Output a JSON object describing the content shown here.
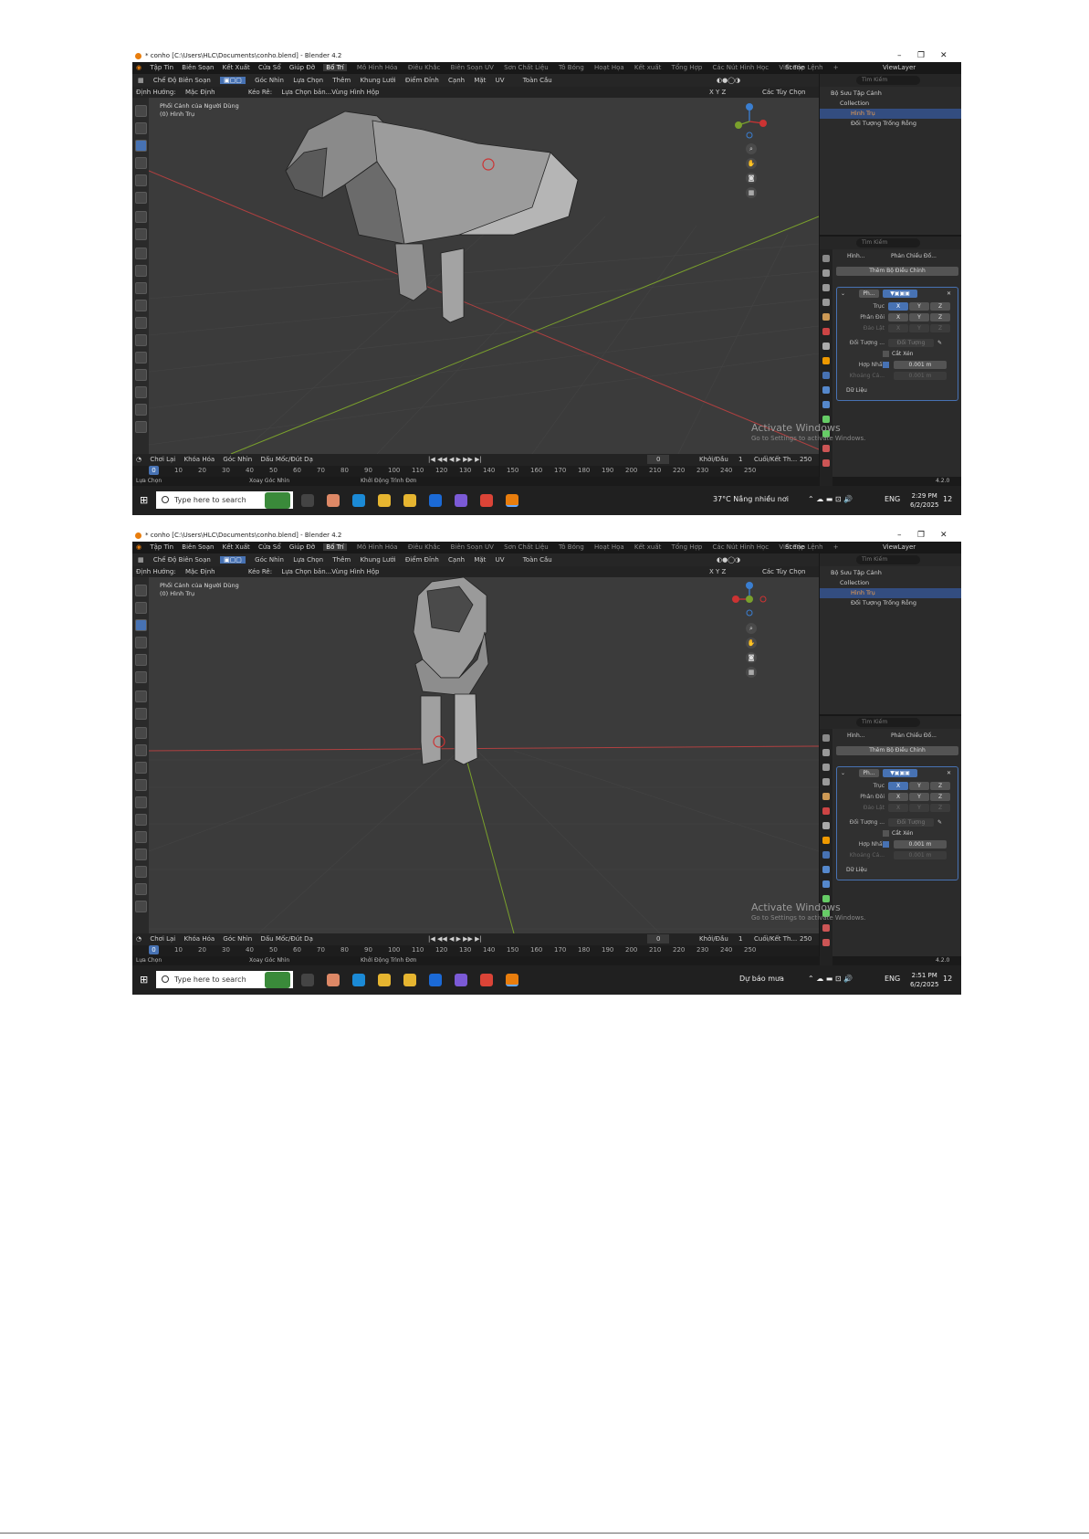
{
  "shots": [
    {
      "title_text": "* conho [C:\\Users\\HLC\\Documents\\conho.blend] - Blender 4.2",
      "menu": [
        "Tập Tin",
        "Biên Soạn",
        "Kết Xuất",
        "Cửa Sổ",
        "Giúp Đỡ"
      ],
      "workspaces": [
        "Bố Trí",
        "Mô Hình Hóa",
        "Điêu Khắc",
        "Biên Soạn UV",
        "Sơn Chất Liệu",
        "Tô Bóng",
        "Hoạt Họa",
        "Kết xuất",
        "Tổng Hợp",
        "Các Nút Hình Học",
        "Viết Tập Lệnh",
        "+"
      ],
      "scene": "Scene",
      "view_layer": "ViewLayer",
      "header": [
        "Chế Độ Biên Soạn",
        "Góc Nhìn",
        "Lựa Chọn",
        "Thêm",
        "Khung Lưới",
        "Điểm Đỉnh",
        "Cạnh",
        "Mặt",
        "UV",
        "Toàn Cầu"
      ],
      "header2": [
        "Định Hướng:",
        "Mặc Định",
        "Kéo Rê:",
        "Lựa Chọn bản...Vùng Hình Hộp"
      ],
      "axes_label": "X Y Z",
      "options_label": "Các Tùy Chọn",
      "view_name": "Phối Cảnh của Người Dùng",
      "object_name": "(0) Hình Trụ",
      "timeline_menu": [
        "Chơi Lại",
        "Khóa Hóa",
        "Góc Nhìn",
        "Dấu Mốc/Đút Dạ"
      ],
      "frame_current": "0",
      "start_label": "Khởi/Đầu",
      "start_value": "1",
      "end_label": "Cuối/Kết Th...",
      "end_value": "250",
      "frame_numbers": [
        "0",
        "10",
        "20",
        "30",
        "40",
        "50",
        "60",
        "70",
        "80",
        "90",
        "100",
        "110",
        "120",
        "130",
        "140",
        "150",
        "160",
        "170",
        "180",
        "190",
        "200",
        "210",
        "220",
        "230",
        "240",
        "250"
      ],
      "status_items": [
        "Lựa Chọn",
        "Xoay Góc Nhìn",
        "Khởi Động Trình Đơn"
      ],
      "version": "4.2.0",
      "outliner": {
        "search_placeholder": "Tìm Kiếm",
        "rows": [
          "Bộ Sưu Tập Cảnh",
          "Collection",
          "Hình Trụ",
          "Đối Tượng Trống Rỗng"
        ]
      },
      "props": {
        "search_placeholder": "Tìm Kiếm",
        "breadcrumb_a": "Hình...",
        "breadcrumb_b": "Phản Chiếu Đố...",
        "add_modifier": "Thêm Bộ Điều Chỉnh",
        "modifier_name": "Ph...",
        "axis_label": "Trục",
        "bisect_label": "Phân Đôi",
        "flip_label": "Đảo Lật",
        "mirror_object_label": "Đối Tượng ...",
        "mirror_object_placeholder": "Đối Tượng",
        "clipping_label": "Cắt Xén",
        "merge_label": "Hợp Nhất",
        "merge_value": "0.001 m",
        "distance_label": "Khoảng Cá...",
        "distance_value": "0.001 m",
        "data_label": "Dữ Liệu",
        "x": "X",
        "y": "Y",
        "z": "Z"
      },
      "activate_title": "Activate Windows",
      "activate_sub": "Go to Settings to activate Windows.",
      "taskbar_search": "Type here to search",
      "weather": "37°C  Nắng nhiều nơi",
      "lang": "ENG",
      "time": "2:29 PM",
      "date": "6/2/2025",
      "notif": "12"
    },
    {
      "title_text": "* conho [C:\\Users\\HLC\\Documents\\conho.blend] - Blender 4.2",
      "menu": [
        "Tập Tin",
        "Biên Soạn",
        "Kết Xuất",
        "Cửa Sổ",
        "Giúp Đỡ"
      ],
      "workspaces": [
        "Bố Trí",
        "Mô Hình Hóa",
        "Điêu Khắc",
        "Biên Soạn UV",
        "Sơn Chất Liệu",
        "Tô Bóng",
        "Hoạt Họa",
        "Kết xuất",
        "Tổng Hợp",
        "Các Nút Hình Học",
        "Viết Tập Lệnh",
        "+"
      ],
      "scene": "Scene",
      "view_layer": "ViewLayer",
      "header": [
        "Chế Độ Biên Soạn",
        "Góc Nhìn",
        "Lựa Chọn",
        "Thêm",
        "Khung Lưới",
        "Điểm Đỉnh",
        "Cạnh",
        "Mặt",
        "UV",
        "Toàn Cầu"
      ],
      "header2": [
        "Định Hướng:",
        "Mặc Định",
        "Kéo Rê:",
        "Lựa Chọn bản...Vùng Hình Hộp"
      ],
      "axes_label": "X Y Z",
      "options_label": "Các Tùy Chọn",
      "view_name": "Phối Cảnh của Người Dùng",
      "object_name": "(0) Hình Trụ",
      "timeline_menu": [
        "Chơi Lại",
        "Khóa Hóa",
        "Góc Nhìn",
        "Dấu Mốc/Đút Dạ"
      ],
      "frame_current": "0",
      "start_label": "Khởi/Đầu",
      "start_value": "1",
      "end_label": "Cuối/Kết Th...",
      "end_value": "250",
      "frame_numbers": [
        "0",
        "10",
        "20",
        "30",
        "40",
        "50",
        "60",
        "70",
        "80",
        "90",
        "100",
        "110",
        "120",
        "130",
        "140",
        "150",
        "160",
        "170",
        "180",
        "190",
        "200",
        "210",
        "220",
        "230",
        "240",
        "250"
      ],
      "status_items": [
        "Lựa Chọn",
        "Xoay Góc Nhìn",
        "Khởi Động Trình Đơn"
      ],
      "version": "4.2.0",
      "outliner": {
        "search_placeholder": "Tìm Kiếm",
        "rows": [
          "Bộ Sưu Tập Cảnh",
          "Collection",
          "Hình Trụ",
          "Đối Tượng Trống Rỗng"
        ]
      },
      "props": {
        "search_placeholder": "Tìm Kiếm",
        "breadcrumb_a": "Hình...",
        "breadcrumb_b": "Phản Chiếu Đố...",
        "add_modifier": "Thêm Bộ Điều Chỉnh",
        "modifier_name": "Ph...",
        "axis_label": "Trục",
        "bisect_label": "Phân Đôi",
        "flip_label": "Đảo Lật",
        "mirror_object_label": "Đối Tượng ...",
        "mirror_object_placeholder": "Đối Tượng",
        "clipping_label": "Cắt Xén",
        "merge_label": "Hợp Nhất",
        "merge_value": "0.001 m",
        "distance_label": "Khoảng Cá...",
        "distance_value": "0.001 m",
        "data_label": "Dữ Liệu",
        "x": "X",
        "y": "Y",
        "z": "Z"
      },
      "activate_title": "Activate Windows",
      "activate_sub": "Go to Settings to activate Windows.",
      "taskbar_search": "Type here to search",
      "weather": "Dự báo mưa",
      "lang": "ENG",
      "time": "2:51 PM",
      "date": "6/2/2025",
      "notif": "12"
    }
  ]
}
